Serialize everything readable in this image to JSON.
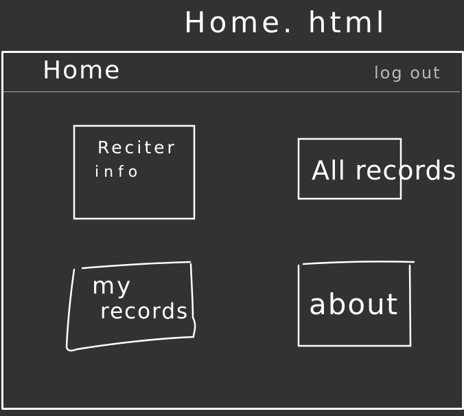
{
  "page": {
    "file_title": "Home. html",
    "background_color": "#323232",
    "stroke_color": "#ffffff"
  },
  "header": {
    "title": "Home",
    "logout_label": "log out"
  },
  "tiles": {
    "reciter_info": {
      "line1": "Reciter",
      "line2": "info"
    },
    "all_records": {
      "label": "All records"
    },
    "my_records": {
      "line1": "my",
      "line2": "records"
    },
    "about": {
      "label": "about"
    }
  }
}
